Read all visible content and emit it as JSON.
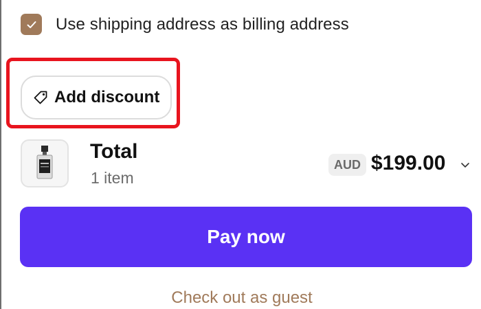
{
  "billing": {
    "label": "Use shipping address as billing address",
    "checked": true,
    "checkbox_icon": "checkmark-icon"
  },
  "discount": {
    "label": "Add discount",
    "icon": "tag-icon"
  },
  "summary": {
    "title": "Total",
    "item_count": "1 item",
    "currency": "AUD",
    "price": "$199.00",
    "chevron_icon": "chevron-down-icon",
    "thumbnail_icon": "perfume-bottle-icon"
  },
  "actions": {
    "pay_label": "Pay now",
    "guest_label": "Check out as guest"
  },
  "colors": {
    "accent_brown": "#a07a5a",
    "accent_purple": "#5a31f4",
    "highlight_red": "#e8141e"
  }
}
